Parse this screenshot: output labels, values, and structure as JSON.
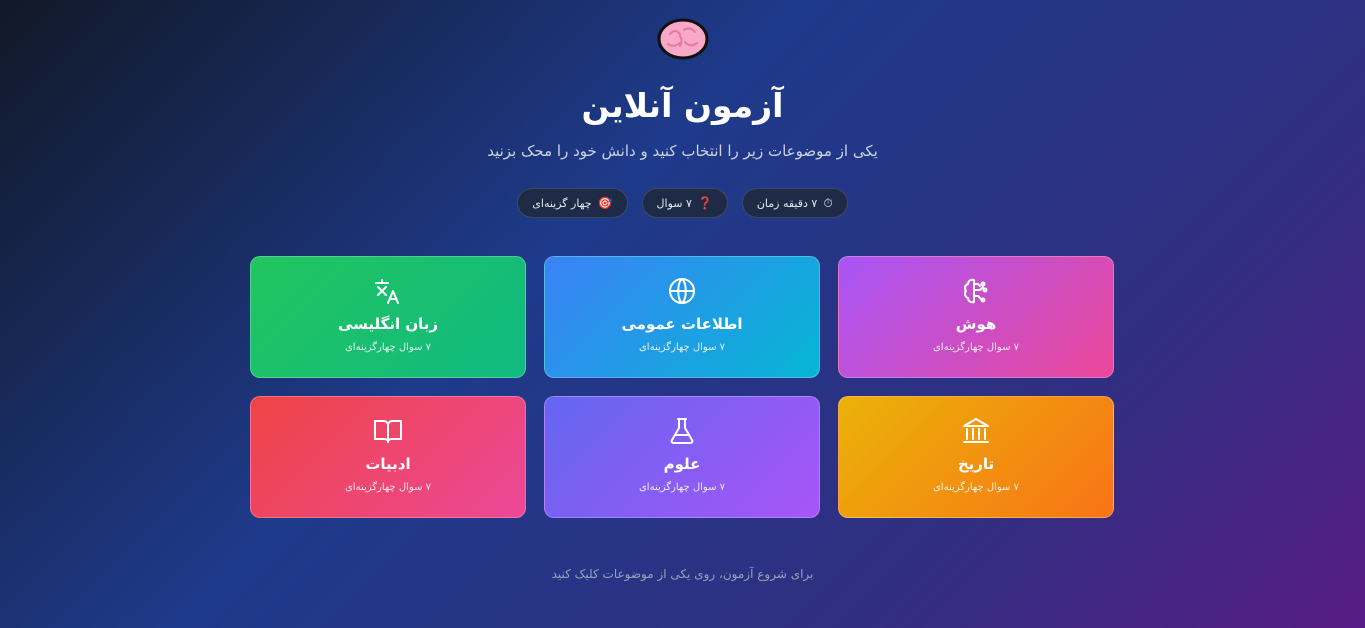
{
  "header": {
    "logo_icon": "brain-icon",
    "title": "آزمون آنلاین",
    "subtitle": "یکی از موضوعات زیر را انتخاب کنید و دانش خود را محک بزنید"
  },
  "badges": [
    {
      "icon": "stopwatch-icon",
      "glyph": "⏱",
      "label": "۷ دقیقه زمان"
    },
    {
      "icon": "question-mark-icon",
      "glyph": "❓",
      "label": "۷ سوال"
    },
    {
      "icon": "target-icon",
      "glyph": "🎯",
      "label": "چهار گزینه‌ای"
    }
  ],
  "categories": [
    {
      "icon": "brain-icon",
      "name": "هوش",
      "meta": "۷ سوال چهارگزینه‌ای",
      "color_from": "#a855f7",
      "color_to": "#ec4899"
    },
    {
      "icon": "globe-icon",
      "name": "اطلاعات عمومی",
      "meta": "۷ سوال چهارگزینه‌ای",
      "color_from": "#3b82f6",
      "color_to": "#06b6d4"
    },
    {
      "icon": "translate-icon",
      "name": "زبان انگلیسی",
      "meta": "۷ سوال چهارگزینه‌ای",
      "color_from": "#22c55e",
      "color_to": "#10b981"
    },
    {
      "icon": "landmark-icon",
      "name": "تاریخ",
      "meta": "۷ سوال چهارگزینه‌ای",
      "color_from": "#eab308",
      "color_to": "#f97316"
    },
    {
      "icon": "flask-icon",
      "name": "علوم",
      "meta": "۷ سوال چهارگزینه‌ای",
      "color_from": "#6366f1",
      "color_to": "#a855f7"
    },
    {
      "icon": "book-open-icon",
      "name": "ادبیات",
      "meta": "۷ سوال چهارگزینه‌ای",
      "color_from": "#ef4444",
      "color_to": "#ec4899"
    }
  ],
  "footer": {
    "text": "برای شروع آزمون، روی یکی از موضوعات کلیک کنید"
  }
}
